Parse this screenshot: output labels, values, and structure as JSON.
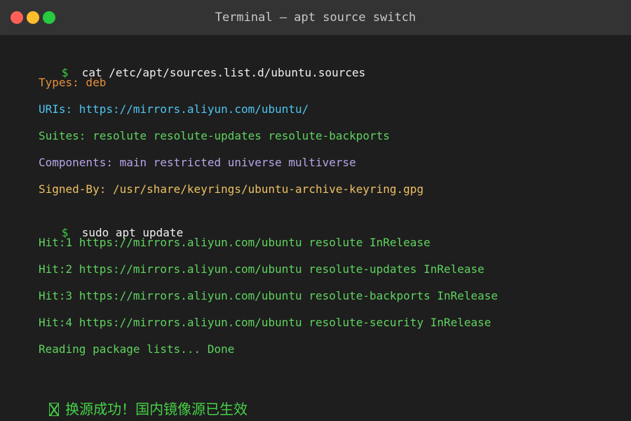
{
  "window": {
    "title": "Terminal — apt source switch"
  },
  "terminal": {
    "prompt_symbol": "$",
    "commands": [
      "cat /etc/apt/sources.list.d/ubuntu.sources",
      "sudo apt update"
    ],
    "sources_file": {
      "types": "Types: deb",
      "uris": "URIs: https://mirrors.aliyun.com/ubuntu/",
      "suites": "Suites: resolute resolute-updates resolute-backports",
      "components": "Components: main restricted universe multiverse",
      "signed_by": "Signed-By: /usr/share/keyrings/ubuntu-archive-keyring.gpg"
    },
    "update_output": [
      "Hit:1 https://mirrors.aliyun.com/ubuntu resolute InRelease",
      "Hit:2 https://mirrors.aliyun.com/ubuntu resolute-updates InRelease",
      "Hit:3 https://mirrors.aliyun.com/ubuntu resolute-backports InRelease",
      "Hit:4 https://mirrors.aliyun.com/ubuntu resolute-security InRelease",
      "Reading package lists... Done"
    ],
    "success_message": "换源成功！国内镜像源已生效",
    "success_icon": "check-box-icon"
  },
  "colors": {
    "background": "#1e1e1e",
    "titlebar": "#333333",
    "prompt": "#3dcf3d",
    "types": "#e5903c",
    "uris": "#4ec5f0",
    "suites": "#5fd35f",
    "components": "#b9a4e8",
    "signed_by": "#ecc063",
    "output": "#5fd35f",
    "success": "#46d046"
  }
}
